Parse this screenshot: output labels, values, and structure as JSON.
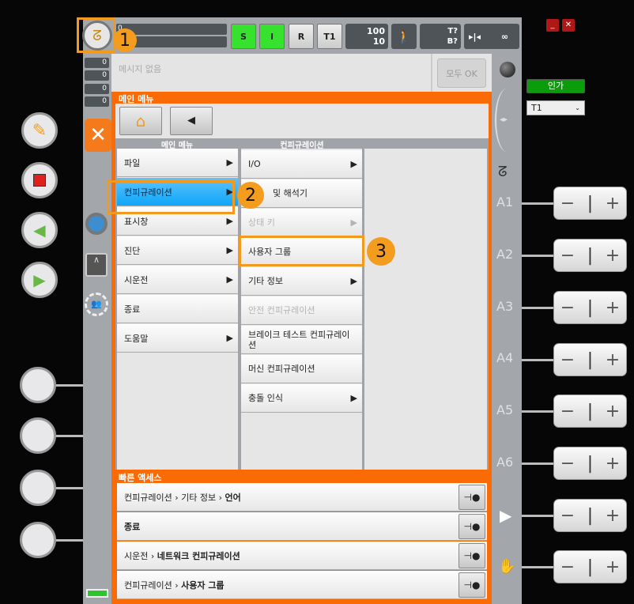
{
  "topbar": {
    "progress_top": "0",
    "s": "S",
    "i": "I",
    "r": "R",
    "mode": "T1",
    "override_prog": "100",
    "override_jog": "10",
    "tool": "T?",
    "base": "B?",
    "incremental": "∞"
  },
  "counters": [
    "0",
    "0",
    "0",
    "0"
  ],
  "messages": {
    "empty": "메시지 없음",
    "ack_all": "모두 OK"
  },
  "main_menu": {
    "header": "메인 메뉴",
    "col1_header": "메인 메뉴",
    "col2_header": "컨피규레이션",
    "col1": [
      {
        "label": "파일",
        "arrow": "▶"
      },
      {
        "label": "컨피규레이션",
        "arrow": "▶"
      },
      {
        "label": "표시창",
        "arrow": "▶"
      },
      {
        "label": "진단",
        "arrow": "▶"
      },
      {
        "label": "시운전",
        "arrow": "▶"
      },
      {
        "label": "종료",
        "arrow": ""
      },
      {
        "label": "도움말",
        "arrow": "▶"
      }
    ],
    "col2": [
      {
        "label": "I/O",
        "arrow": "▶"
      },
      {
        "label": "및 해석기",
        "arrow": ""
      },
      {
        "label": "상태 키",
        "arrow": "▶"
      },
      {
        "label": "사용자 그룹",
        "arrow": ""
      },
      {
        "label": "기타 정보",
        "arrow": "▶"
      },
      {
        "label": "안전 컨피규레이션",
        "arrow": ""
      },
      {
        "label": "브레이크 테스트 컨피규레이션",
        "arrow": ""
      },
      {
        "label": "머신 컨피규레이션",
        "arrow": ""
      },
      {
        "label": "충돌 인식",
        "arrow": "▶"
      }
    ]
  },
  "quick_access": {
    "header": "빠른 액세스",
    "items": [
      {
        "path": "컨피규레이션 › 기타 정보 › ",
        "target": "언어"
      },
      {
        "path": "",
        "target": "종료"
      },
      {
        "path": "시운전 › ",
        "target": "네트워크 컨피규레이션"
      },
      {
        "path": "컨피규레이션 › ",
        "target": "사용자 그룹"
      }
    ]
  },
  "axes": [
    "A1",
    "A2",
    "A3",
    "A4",
    "A5",
    "A6"
  ],
  "right": {
    "enable": "인가",
    "mode_select": "T1"
  },
  "annotations": [
    "1",
    "2",
    "3"
  ]
}
